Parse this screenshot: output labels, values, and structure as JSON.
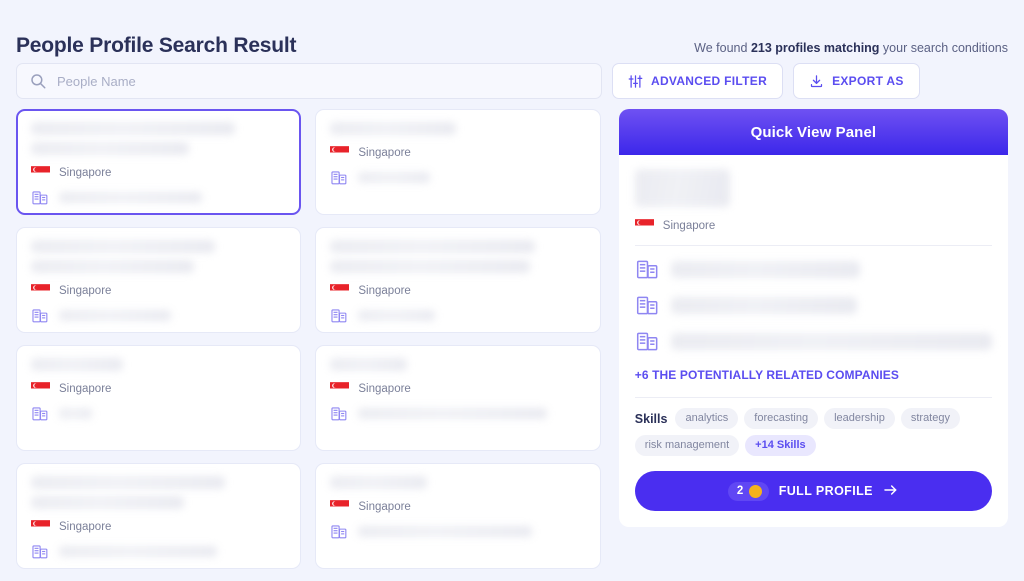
{
  "header": {
    "title": "People Profile Search Result",
    "result_prefix": "We found ",
    "result_bold": "213 profiles matching",
    "result_suffix": " your search conditions"
  },
  "search": {
    "placeholder": "People Name",
    "value": "",
    "icon": "search-icon"
  },
  "toolbar": {
    "advanced_filter_label": "ADVANCED FILTER",
    "advanced_filter_icon": "sliders-icon",
    "export_label": "EXPORT AS",
    "export_icon": "download-icon"
  },
  "cards": [
    {
      "location": "Singapore",
      "flag": "singapore-flag-icon",
      "selected": true,
      "name_w1": "80%",
      "name_w2": "62%",
      "company_w": "56%"
    },
    {
      "location": "Singapore",
      "flag": "singapore-flag-icon",
      "selected": false,
      "name_w1": "49%",
      "name_w2": "0%",
      "company_w": "28%"
    },
    {
      "location": "Singapore",
      "flag": "singapore-flag-icon",
      "selected": false,
      "name_w1": "72%",
      "name_w2": "64%",
      "company_w": "44%"
    },
    {
      "location": "Singapore",
      "flag": "singapore-flag-icon",
      "selected": false,
      "name_w1": "80%",
      "name_w2": "78%",
      "company_w": "30%"
    },
    {
      "location": "Singapore",
      "flag": "singapore-flag-icon",
      "selected": false,
      "name_w1": "36%",
      "name_w2": "0%",
      "company_w": "13%"
    },
    {
      "location": "Singapore",
      "flag": "singapore-flag-icon",
      "selected": false,
      "name_w1": "30%",
      "name_w2": "0%",
      "company_w": "74%"
    },
    {
      "location": "Singapore",
      "flag": "singapore-flag-icon",
      "selected": false,
      "name_w1": "76%",
      "name_w2": "60%",
      "company_w": "62%"
    },
    {
      "location": "Singapore",
      "flag": "singapore-flag-icon",
      "selected": false,
      "name_w1": "38%",
      "name_w2": "0%",
      "company_w": "68%"
    }
  ],
  "quick_view": {
    "title": "Quick View Panel",
    "location": "Singapore",
    "flag": "singapore-flag-icon",
    "companies": [
      {
        "icon": "building-icon",
        "width": "53%"
      },
      {
        "icon": "building-icon",
        "width": "52%"
      },
      {
        "icon": "building-icon",
        "width": "96%"
      }
    ],
    "related_link": "+6 THE POTENTIALLY RELATED COMPANIES",
    "skills_label": "Skills",
    "skills": [
      "analytics",
      "forecasting",
      "leadership",
      "strategy",
      "risk management"
    ],
    "skills_more": "+14 Skills",
    "full_profile_label": "FULL PROFILE",
    "full_profile_credits": "2",
    "full_profile_arrow": "arrow-right-icon",
    "coin_icon": "coin-icon"
  },
  "colors": {
    "background": "#f2f4fd",
    "accent": "#5b4df0",
    "panel_gradient_top": "#6f51f2",
    "panel_gradient_bottom": "#3c27ea",
    "button": "#4a2ef0",
    "coin": "#f5b21c",
    "flag_red": "#e8232a",
    "title": "#2b3159"
  }
}
